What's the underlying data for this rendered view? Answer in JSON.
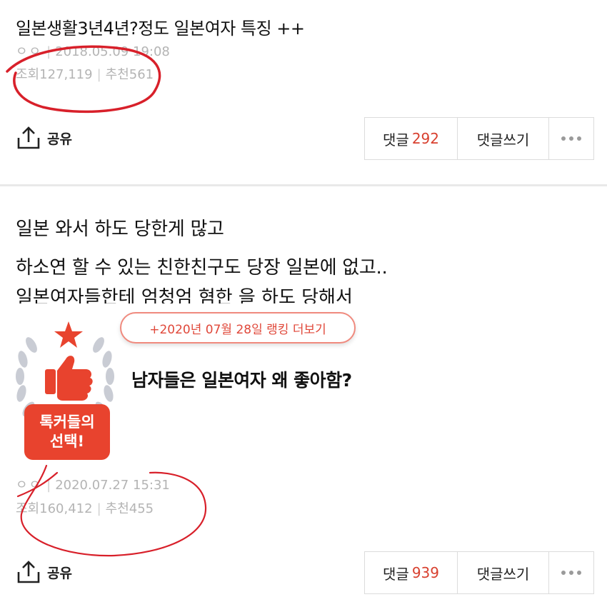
{
  "post1": {
    "title": "일본생활3년4년?정도 일본여자 특징 ++",
    "author": "ㅇㅇ",
    "date": "2018.05.09 19:08",
    "views_label": "조회",
    "views": "127,119",
    "likes_label": "추천",
    "likes": "561",
    "share_label": "공유",
    "comments_label": "댓글",
    "comments_count": "292",
    "write_comment_label": "댓글쓰기"
  },
  "post2": {
    "lines": [
      "일본 와서 하도 당한게 많고",
      "하소연 할 수 있는 친한친구도 당장 일본에 없고..",
      "일본여자들한테 엄청엄 혐한 을 하도 당해서"
    ],
    "ranking_link": "+2020년 07월 28일 랭킹 더보기",
    "badge_line1": "톡커들의",
    "badge_line2": "선택!",
    "title": "남자들은 일본여자 왜 좋아함?",
    "author": "ㅇㅇ",
    "date": "2020.07.27 15:31",
    "views_label": "조회",
    "views": "160,412",
    "likes_label": "추천",
    "likes": "455",
    "share_label": "공유",
    "comments_label": "댓글",
    "comments_count": "939",
    "write_comment_label": "댓글쓰기"
  },
  "colors": {
    "accent_red": "#d8402f",
    "meta_gray": "#b4b4b4",
    "badge_red": "#e8432e",
    "annotation_red": "#d8202a"
  }
}
